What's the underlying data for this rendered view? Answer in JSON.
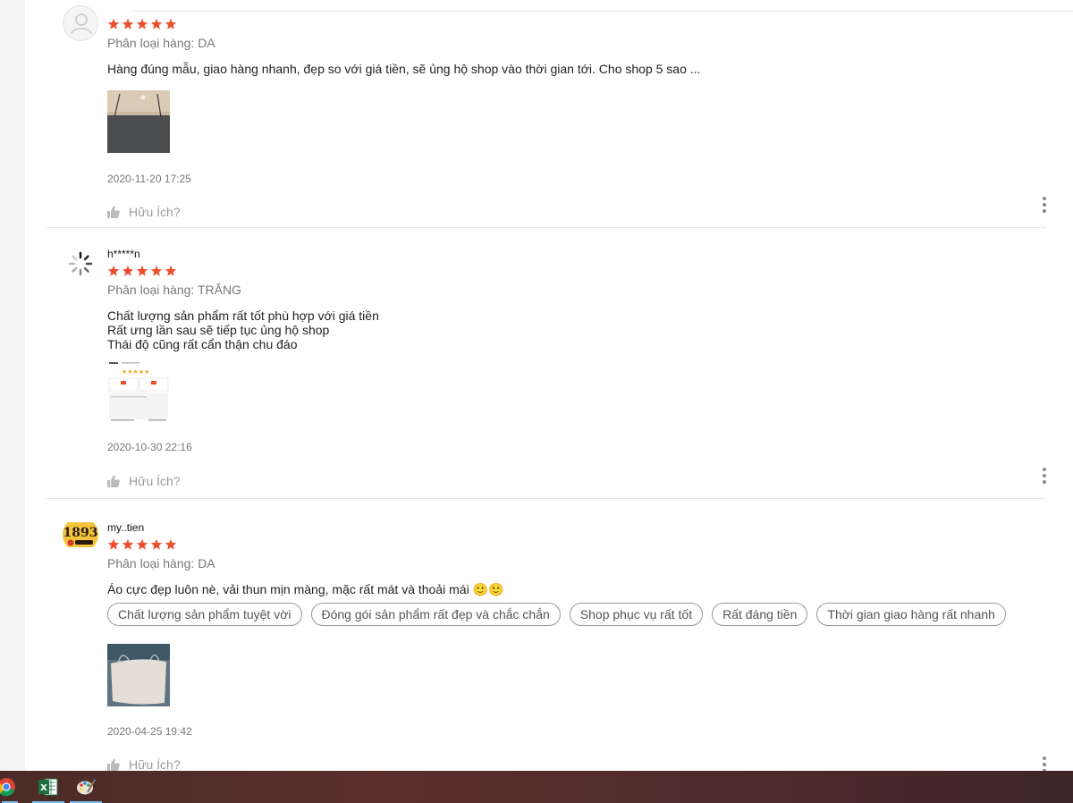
{
  "reviews": [
    {
      "username": "",
      "avatar": "default-avatar-icon",
      "rating": 5,
      "variant": "Phân loại hàng: DA",
      "comment": "Hàng đúng mẫu, giao hàng nhanh, đẹp so với giá tiền, sẽ ủng hộ shop vào thời gian tới. Cho shop 5 sao ...",
      "tags": [],
      "time": "2020-11-20 17:25",
      "helpful": "Hữu Ích?"
    },
    {
      "username": "h*****n",
      "avatar": "loading-spinner-icon",
      "rating": 5,
      "variant": "Phân loại hàng: TRẮNG",
      "comment": "Chất lượng sản phẩm rất tốt phù hợp với giá tiền\nRất ưng lần sau sẽ tiếp tục ủng hộ shop\nThái độ cũng rất cẩn thận chu đáo",
      "tags": [],
      "time": "2020-10-30 22:16",
      "helpful": "Hữu Ích?"
    },
    {
      "username": "my..tien",
      "avatar": "1893-logo-avatar",
      "avatar_text": "1893",
      "rating": 5,
      "variant": "Phân loại hàng: DA",
      "comment": "Áo cực đẹp luôn nè, vải thun mịn màng, mặc rất mát và thoải mái 🙂🙂",
      "tags": [
        "Chất lượng sản phẩm tuyệt vời",
        "Đóng gói sản phẩm rất đẹp và chắc chắn",
        "Shop phục vụ rất tốt",
        "Rất đáng tiền",
        "Thời gian giao hàng rất nhanh"
      ],
      "time": "2020-04-25 19:42",
      "helpful": "Hữu Ích?"
    }
  ],
  "taskbar": {
    "items": [
      "chrome-icon",
      "excel-icon",
      "paint-icon"
    ]
  },
  "colors": {
    "star": "#ee4d2d",
    "taskbar": "#4f2a2c"
  }
}
